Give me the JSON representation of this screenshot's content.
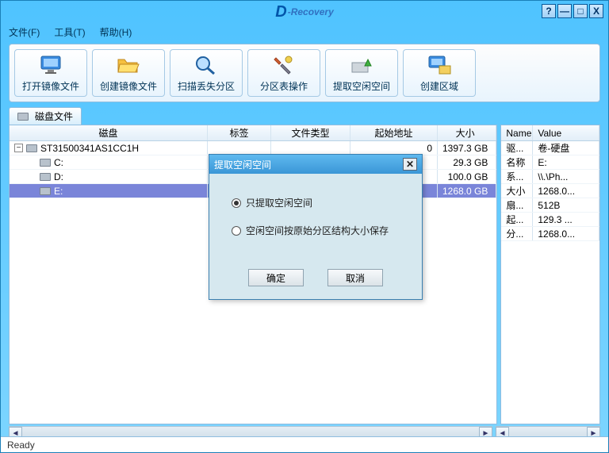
{
  "app": {
    "logo_d": "D",
    "logo_rest": "-Recovery"
  },
  "win": {
    "help": "?",
    "min": "—",
    "max": "□",
    "close": "X"
  },
  "menu": {
    "file": "文件(F)",
    "tool": "工具(T)",
    "help": "帮助(H)"
  },
  "toolbar": [
    {
      "id": "open-image",
      "label": "打开镜像文件"
    },
    {
      "id": "create-image",
      "label": "创建镜像文件"
    },
    {
      "id": "scan-lost",
      "label": "扫描丢失分区"
    },
    {
      "id": "partition-ops",
      "label": "分区表操作"
    },
    {
      "id": "extract-free",
      "label": "提取空闲空间"
    },
    {
      "id": "create-area",
      "label": "创建区域"
    }
  ],
  "tab": {
    "label": "磁盘文件"
  },
  "left_headers": {
    "disk": "磁盘",
    "label": "标签",
    "type": "文件类型",
    "start": "起始地址",
    "size": "大小"
  },
  "disks": {
    "root_name": "ST31500341AS1CC1H",
    "root_start": "0",
    "root_size": "1397.3 GB",
    "parts": [
      {
        "name": "C:",
        "size": "29.3 GB"
      },
      {
        "name": "D:",
        "size": "100.0 GB"
      },
      {
        "name": "E:",
        "size": "1268.0 GB",
        "selected": true
      }
    ]
  },
  "right_headers": {
    "name": "Name",
    "value": "Value"
  },
  "props": [
    {
      "name": "驱...",
      "value": "卷-硬盘"
    },
    {
      "name": "名称",
      "value": "E:"
    },
    {
      "name": "系...",
      "value": "\\\\.\\Ph..."
    },
    {
      "name": "大小",
      "value": "1268.0..."
    },
    {
      "name": "扇...",
      "value": "512B"
    },
    {
      "name": "起...",
      "value": "129.3 ..."
    },
    {
      "name": "分...",
      "value": "1268.0..."
    }
  ],
  "dialog": {
    "title": "提取空闲空间",
    "opt1": "只提取空闲空间",
    "opt2": "空闲空间按原始分区结构大小保存",
    "ok": "确定",
    "cancel": "取消"
  },
  "status": "Ready",
  "scroll": {
    "left": "◄",
    "right": "►"
  }
}
